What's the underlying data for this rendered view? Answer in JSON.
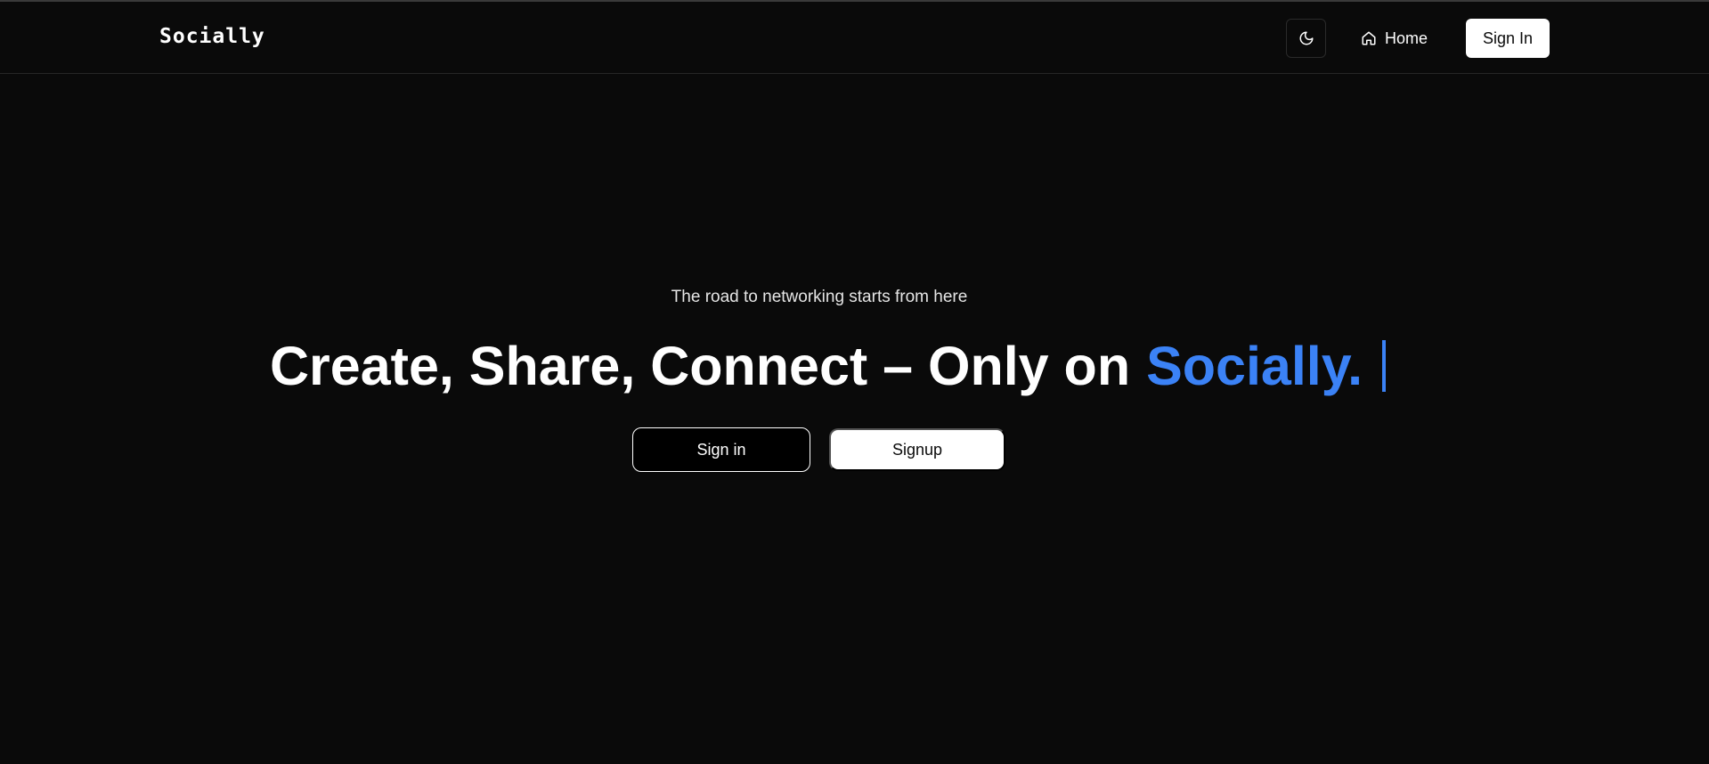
{
  "header": {
    "brand": "Socially",
    "theme_toggle_icon": "moon-icon",
    "home_icon": "home-icon",
    "home_label": "Home",
    "signin_label": "Sign In"
  },
  "hero": {
    "tagline": "The road to networking starts from here",
    "headline": "Create, Share, Connect – Only on",
    "headline_accent": "Socially.",
    "accent_color": "#3b82f6",
    "signin_button": "Sign in",
    "signup_button": "Signup"
  },
  "colors": {
    "background": "#0a0a0a",
    "accent": "#3b82f6"
  }
}
